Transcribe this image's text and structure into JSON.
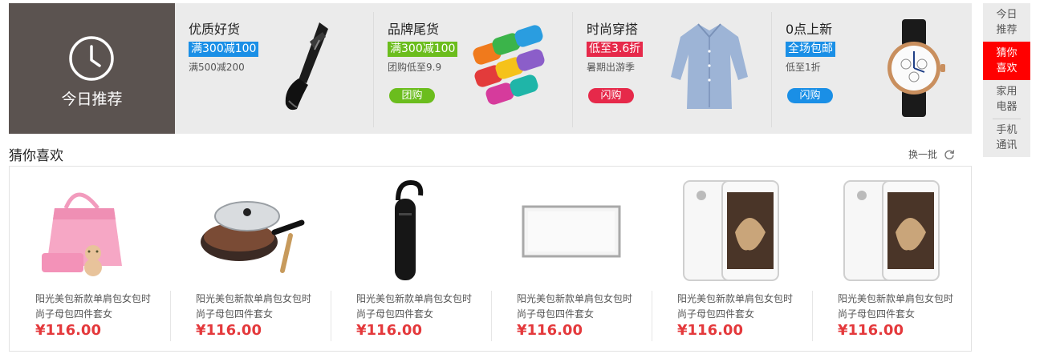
{
  "colors": {
    "accent_red": "#ff0000",
    "price_red": "#e4393c",
    "today_bg": "#5b5350",
    "banner_bg": "#ebebeb"
  },
  "today": {
    "icon": "clock-icon",
    "label": "今日推荐"
  },
  "deals": [
    {
      "title": "优质好货",
      "promo": "满300减100",
      "promo_color": "#1a8fe6",
      "sub": "满500减200",
      "button": "",
      "button_color": "",
      "image": "handheld-vacuum"
    },
    {
      "title": "品牌尾货",
      "promo": "满300减100",
      "promo_color": "#6bbd1d",
      "sub": "团购低至9.9",
      "button": "团购",
      "button_color": "#6bbd1d",
      "image": "folded-towels"
    },
    {
      "title": "时尚穿搭",
      "promo": "低至3.6折",
      "promo_color": "#e6294a",
      "sub": "暑期出游季",
      "button": "闪购",
      "button_color": "#e6294a",
      "image": "blue-shirt"
    },
    {
      "title": "0点上新",
      "promo": "全场包邮",
      "promo_color": "#1a8fe6",
      "sub": "低至1折",
      "button": "闪购",
      "button_color": "#1a8fe6",
      "image": "wrist-watch"
    }
  ],
  "side_tabs": [
    {
      "line1": "今日",
      "line2": "推荐",
      "active": false
    },
    {
      "line1": "猜你",
      "line2": "喜欢",
      "active": true
    },
    {
      "line1": "家用",
      "line2": "电器",
      "active": false
    },
    {
      "line1": "手机",
      "line2": "通讯",
      "active": false
    }
  ],
  "guess": {
    "title": "猜你喜欢",
    "refresh_label": "换一批",
    "refresh_icon": "refresh-icon",
    "products": [
      {
        "image": "pink-handbag",
        "name": "阳光美包新款单肩包女包时尚子母包四件套女",
        "price": "¥116.00"
      },
      {
        "image": "frying-pan",
        "name": "阳光美包新款单肩包女包时尚子母包四件套女",
        "price": "¥116.00"
      },
      {
        "image": "bluetooth-earpiece",
        "name": "阳光美包新款单肩包女包时尚子母包四件套女",
        "price": "¥116.00"
      },
      {
        "image": "led-panel-light",
        "name": "阳光美包新款单肩包女包时尚子母包四件套女",
        "price": "¥116.00"
      },
      {
        "image": "white-smartphone",
        "name": "阳光美包新款单肩包女包时尚子母包四件套女",
        "price": "¥116.00"
      },
      {
        "image": "white-smartphone",
        "name": "阳光美包新款单肩包女包时尚子母包四件套女",
        "price": "¥116.00"
      }
    ]
  }
}
